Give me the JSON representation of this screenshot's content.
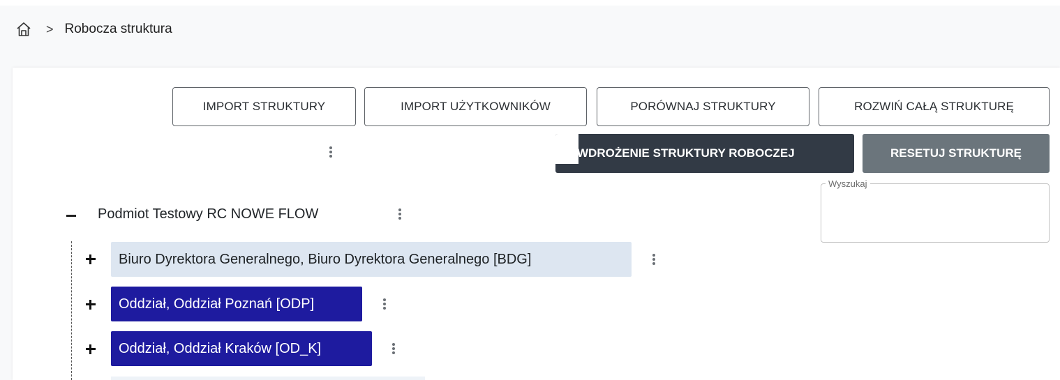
{
  "breadcrumb": {
    "home_icon": "home-icon",
    "separator": ">",
    "current": "Robocza struktura"
  },
  "toolbar": {
    "import_structure": "IMPORT STRUKTURY",
    "import_users": "IMPORT UŻYTKOWNIKÓW",
    "compare_structures": "PORÓWNAJ STRUKTURY",
    "expand_all": "ROZWIŃ CAŁĄ STRUKTURĘ",
    "deploy_working": "WDROŻENIE STRUKTURY ROBOCZEJ",
    "reset_structure": "RESETUJ STRUKTURĘ",
    "more_icon": "more-vertical-icon"
  },
  "search": {
    "label": "Wyszukaj",
    "value": ""
  },
  "tree": {
    "root": {
      "toggle": "−",
      "label": "Podmiot Testowy RC NOWE FLOW"
    },
    "nodes": [
      {
        "label": "Biuro Dyrektora Generalnego, Biuro Dyrektora Generalnego [BDG]",
        "style": "light"
      },
      {
        "label": "Oddział, Oddział Poznań [ODP]",
        "style": "blue"
      },
      {
        "label": "Oddział, Oddział Kraków [OD_K]",
        "style": "blue"
      }
    ]
  },
  "colors": {
    "dark_button": "#323a45",
    "gray_button": "#6b757c",
    "node_blue": "#1e1b9f",
    "node_light": "#dde6f1"
  }
}
